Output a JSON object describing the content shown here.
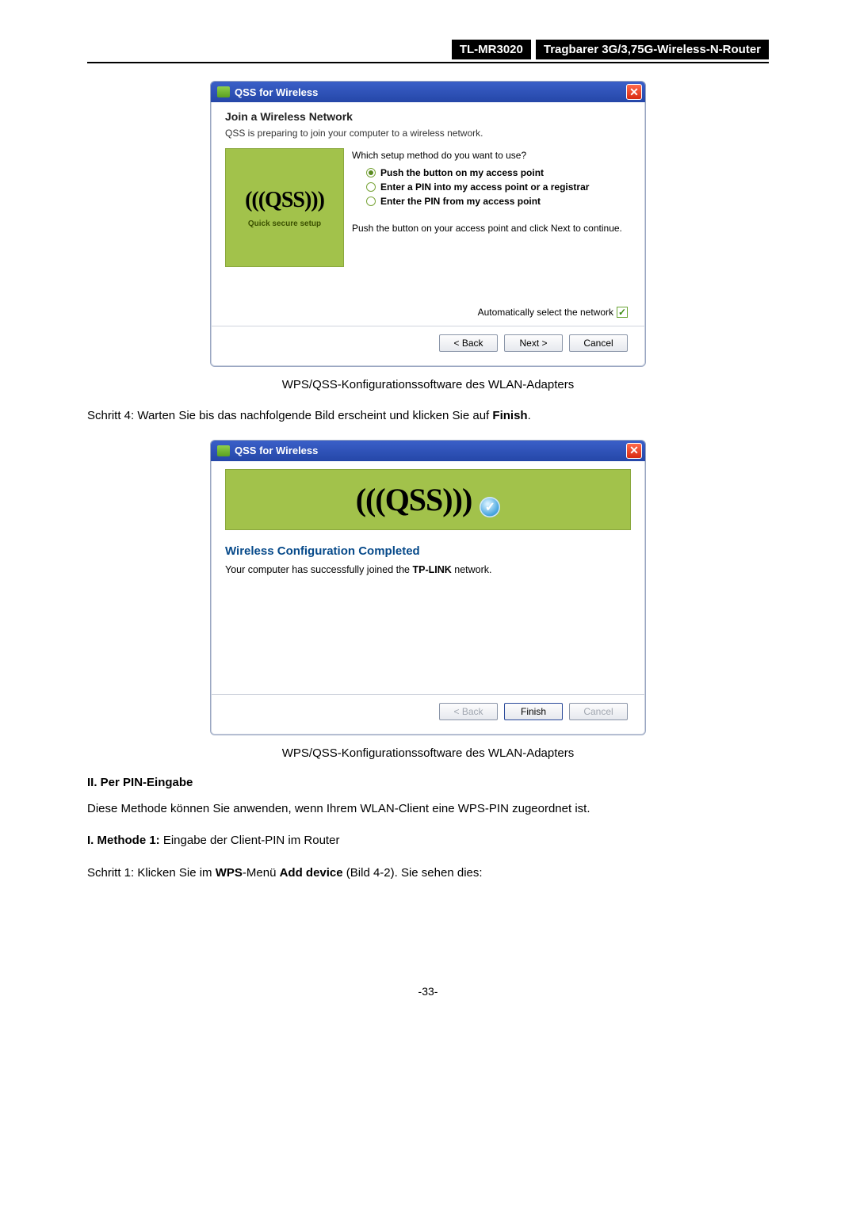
{
  "header": {
    "model": "TL-MR3020",
    "name": "Tragbarer 3G/3,75G-Wireless-N-Router"
  },
  "dialog1": {
    "title": "QSS for Wireless",
    "heading": "Join a Wireless Network",
    "subheading": "QSS is preparing to join your computer to a wireless network.",
    "brand": "(((QSS)))",
    "brand_caption": "Quick secure setup",
    "question": "Which setup method do you want to use?",
    "options": [
      "Push the button on my access point",
      "Enter a PIN into my access point or a registrar",
      "Enter the PIN from my access point"
    ],
    "hint": "Push the button on your access point and click Next to continue.",
    "auto_label": "Automatically select the network",
    "back": "< Back",
    "next": "Next >",
    "cancel": "Cancel"
  },
  "caption1": "WPS/QSS-Konfigurationssoftware des WLAN-Adapters",
  "step4": {
    "prefix": "Schritt 4: Warten Sie bis das nachfolgende Bild erscheint und klicken Sie auf ",
    "bold": "Finish",
    "suffix": "."
  },
  "dialog2": {
    "title": "QSS for Wireless",
    "brand": "(((QSS)))",
    "heading": "Wireless Configuration Completed",
    "text_before": "Your computer has successfully joined the ",
    "text_bold": "TP-LINK",
    "text_after": " network.",
    "back": "< Back",
    "finish": "Finish",
    "cancel": "Cancel"
  },
  "caption2": "WPS/QSS-Konfigurationssoftware des WLAN-Adapters",
  "section2": "II.   Per PIN-Eingabe",
  "pin_para": "Diese Methode können Sie anwenden, wenn Ihrem WLAN-Client eine WPS-PIN zugeordnet ist.",
  "method1": {
    "bold": "I.    Methode 1:",
    "rest": " Eingabe der Client-PIN im Router"
  },
  "step1": {
    "prefix": "Schritt 1:  Klicken Sie im ",
    "b1": "WPS",
    "mid": "-Menü ",
    "b2": "Add device",
    "suffix": " (Bild 4-2). Sie sehen dies:"
  },
  "page_num": "-33-"
}
